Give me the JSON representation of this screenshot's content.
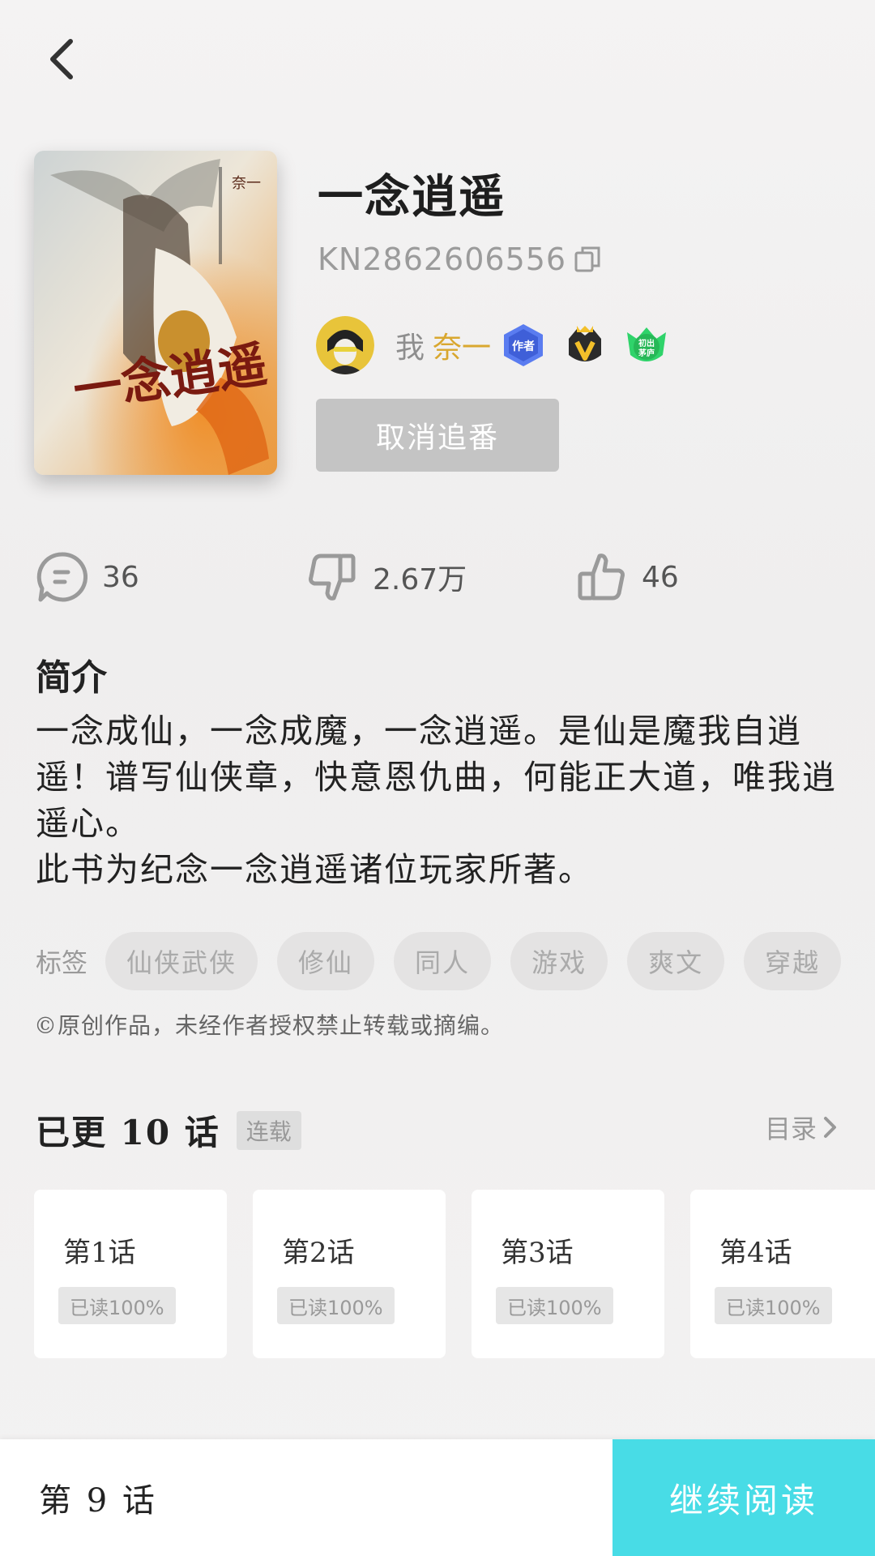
{
  "book": {
    "title": "一念逍遥",
    "id": "KN2862606556",
    "cover_title": "一念逍遥",
    "cover_author": "奈一"
  },
  "author": {
    "me_label": "我",
    "name": "奈一",
    "badges": [
      "author-badge",
      "vip-badge",
      "newcomer-badge"
    ]
  },
  "actions": {
    "unfollow_label": "取消追番"
  },
  "stats": {
    "comments": "36",
    "dislikes": "2.67万",
    "likes": "46"
  },
  "intro": {
    "heading": "简介",
    "text": "一念成仙，一念成魔，一念逍遥。是仙是魔我自逍遥！谱写仙侠章，快意恩仇曲，何能正大道，唯我逍遥心。\n此书为纪念一念逍遥诸位玩家所著。"
  },
  "tags": {
    "label": "标签",
    "items": [
      "仙侠武侠",
      "修仙",
      "同人",
      "游戏",
      "爽文",
      "穿越"
    ]
  },
  "copyright": "©原创作品，未经作者授权禁止转载或摘编。",
  "chapters": {
    "updated_label": "已更 10 话",
    "status": "连载",
    "toc_label": "目录",
    "items": [
      {
        "name": "第1话",
        "progress": "已读100%"
      },
      {
        "name": "第2话",
        "progress": "已读100%"
      },
      {
        "name": "第3话",
        "progress": "已读100%"
      },
      {
        "name": "第4话",
        "progress": "已读100%"
      }
    ]
  },
  "bottom_bar": {
    "current_chapter": "第 9 话",
    "continue_label": "继续阅读"
  },
  "colors": {
    "accent": "#48dce6",
    "author_name": "#d9a72f",
    "unfollow_bg": "#c4c4c4"
  }
}
